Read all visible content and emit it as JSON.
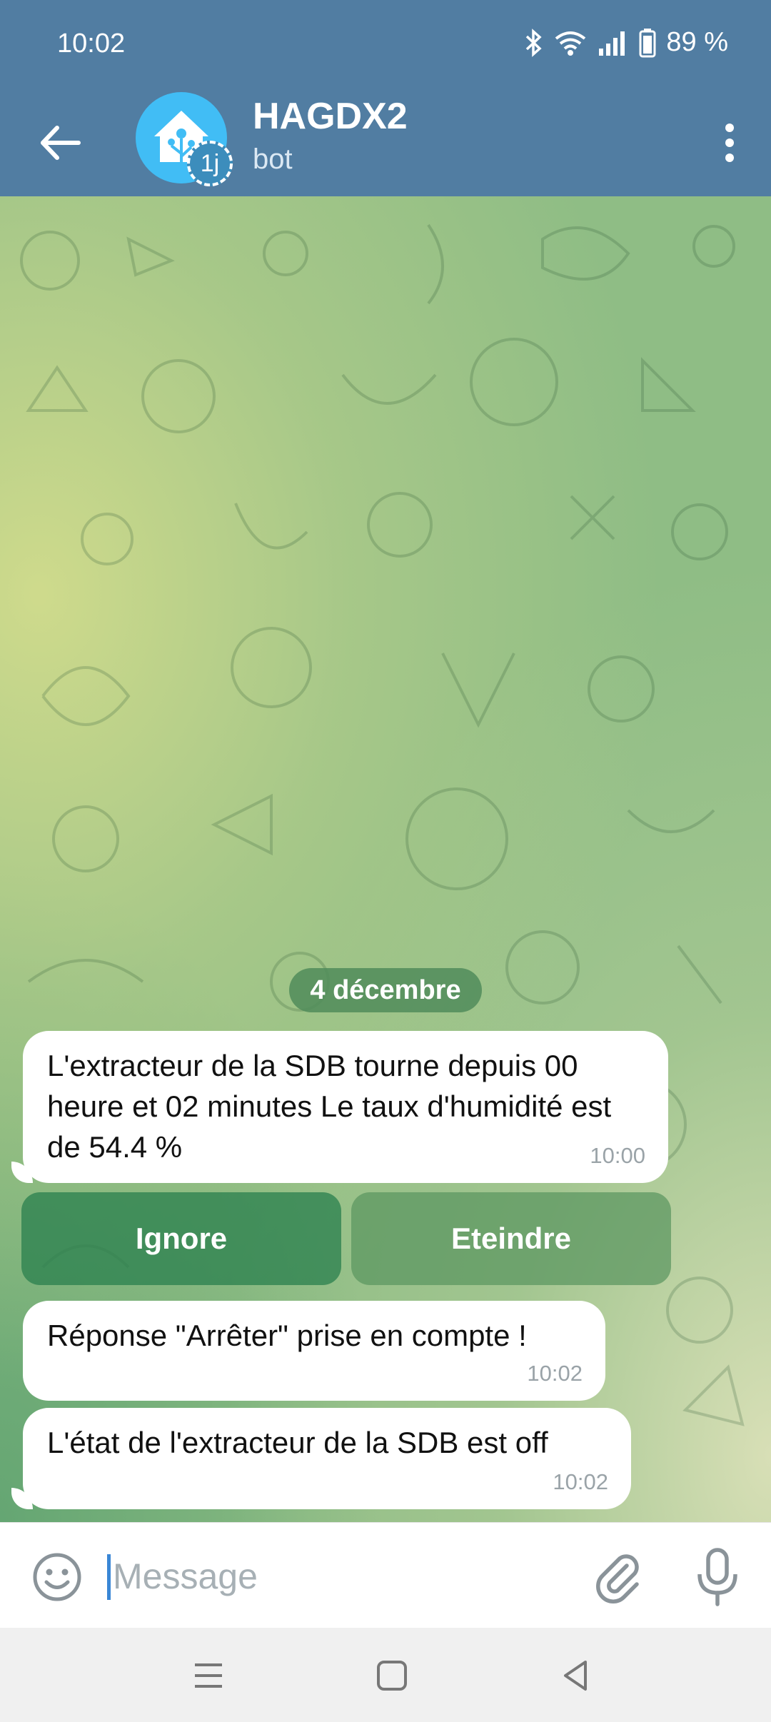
{
  "status": {
    "time": "10:02",
    "battery": "89 %"
  },
  "header": {
    "title": "HAGDX2",
    "subtitle": "bot",
    "avatar_badge": "1j"
  },
  "chat": {
    "date": "4 décembre",
    "messages": [
      {
        "text": "L'extracteur de la SDB tourne depuis 00 heure et 02 minutes Le taux d'humidité est de 54.4 %",
        "time": "10:00"
      },
      {
        "text": "Réponse \"Arrêter\" prise en compte !",
        "time": "10:02"
      },
      {
        "text": "L'état de l'extracteur de la SDB est off",
        "time": "10:02"
      }
    ],
    "inline_buttons": [
      "Ignore",
      "Eteindre"
    ]
  },
  "input": {
    "placeholder": "Message"
  },
  "colors": {
    "header": "#517da2",
    "accent": "#3a87d6",
    "inline_button": "#2d8250"
  },
  "icons": [
    "back-arrow-icon",
    "more-vert-icon",
    "emoji-icon",
    "attach-icon",
    "mic-icon",
    "bluetooth-icon",
    "wifi-icon",
    "signal-icon",
    "battery-icon"
  ]
}
